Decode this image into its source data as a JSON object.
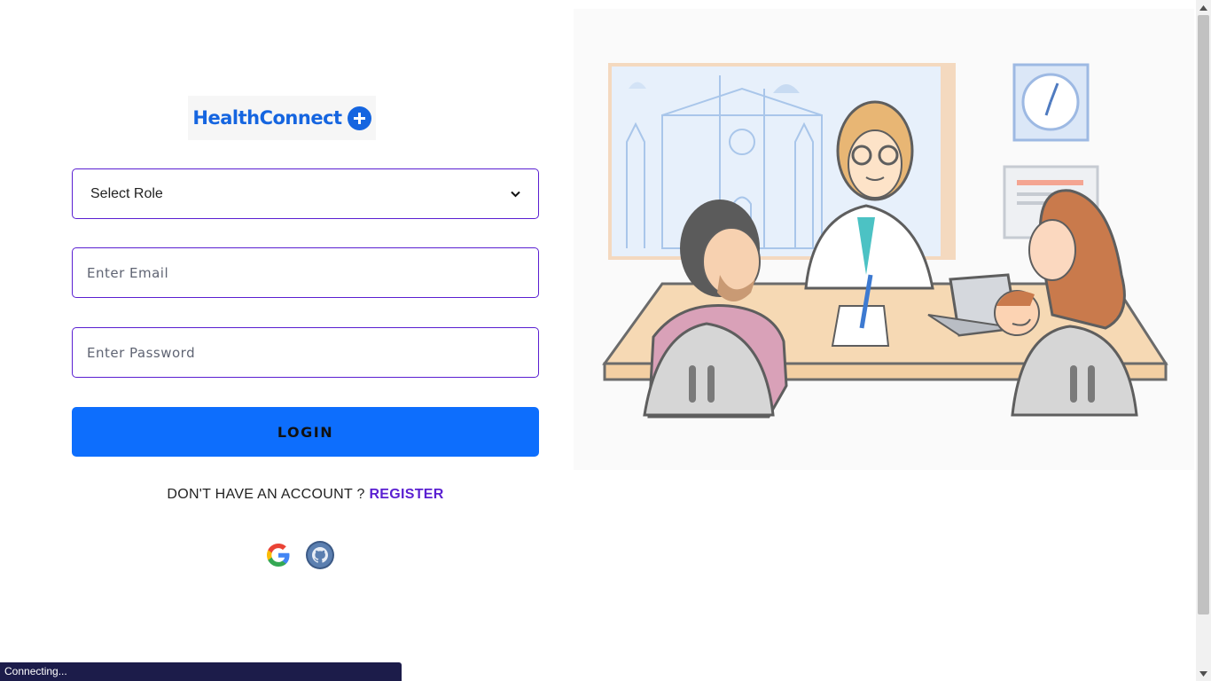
{
  "brand": {
    "name": "HealthConnect",
    "color": "#1565e0"
  },
  "form": {
    "role_select": {
      "value": "Select Role"
    },
    "email": {
      "placeholder": "Enter Email"
    },
    "password": {
      "placeholder": "Enter Password"
    },
    "login_label": "LOGIN",
    "signup_prompt": "DON'T HAVE AN ACCOUNT ? ",
    "register_label": "REGISTER"
  },
  "social": [
    {
      "icon": "google-icon"
    },
    {
      "icon": "github-icon"
    }
  ],
  "colors": {
    "accent": "#5a1fd1",
    "primary_button": "#0d6efd"
  },
  "status_bar": {
    "text": "Connecting..."
  }
}
